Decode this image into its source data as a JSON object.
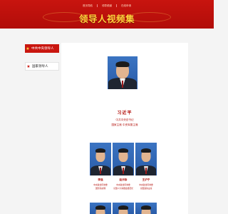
{
  "header": {
    "nav": [
      "首页导航",
      "领导频道",
      "在线申请"
    ],
    "title": "领导人视频集"
  },
  "sidebar": {
    "items": [
      {
        "label": "中共中央领导人",
        "active": true
      },
      {
        "label": "国家领导人",
        "active": false
      }
    ]
  },
  "main_leader": {
    "name": "习近平",
    "titles": [
      "中共中央总书记",
      "国家主席 中央军委主席"
    ]
  },
  "leaders": [
    {
      "name": "李强",
      "titles": [
        "中央政治局常委",
        "国务院总理"
      ]
    },
    {
      "name": "赵乐际",
      "titles": [
        "中央政治局常委",
        "全国人大常委会委员长"
      ]
    },
    {
      "name": "王沪宁",
      "titles": [
        "中央政治局常委",
        "全国政协主席"
      ]
    }
  ],
  "colors": {
    "header_red": "#c8140f",
    "title_gold": "#ffd23c",
    "text_red": "#b3120d"
  }
}
